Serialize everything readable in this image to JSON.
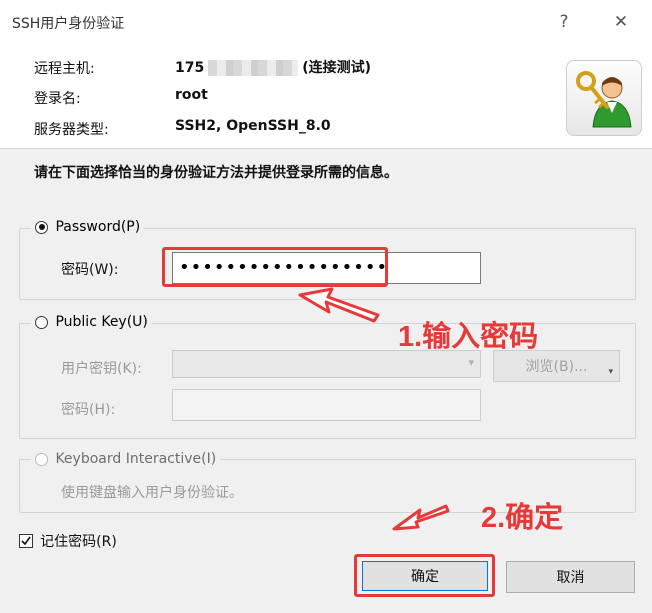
{
  "window": {
    "title": "SSH用户身份验证",
    "help_glyph": "?",
    "close_glyph": "✕"
  },
  "header": {
    "host_label": "远程主机:",
    "host_value_prefix": "175",
    "host_value_suffix": "(连接测试)",
    "login_label": "登录名:",
    "login_value": "root",
    "server_type_label": "服务器类型:",
    "server_type_value": "SSH2, OpenSSH_8.0"
  },
  "instruction": "请在下面选择恰当的身份验证方法并提供登录所需的信息。",
  "password_group": {
    "radio_label": "Password(P)",
    "selected": true,
    "field_label": "密码(W):",
    "field_value": "••••••••••••••••••"
  },
  "publickey_group": {
    "radio_label": "Public Key(U)",
    "selected": false,
    "user_key_label": "用户密钥(K):",
    "browse_label": "浏览(B)...",
    "passphrase_label": "密码(H):"
  },
  "keyboard_group": {
    "radio_label": "Keyboard Interactive(I)",
    "selected": false,
    "description": "使用键盘输入用户身份验证。"
  },
  "remember": {
    "label": "记住密码(R)",
    "checked": true
  },
  "buttons": {
    "ok": "确定",
    "cancel": "取消"
  },
  "annotations": {
    "step1": "1.输入密码",
    "step2": "2.确定",
    "color": "#e63a3a"
  }
}
